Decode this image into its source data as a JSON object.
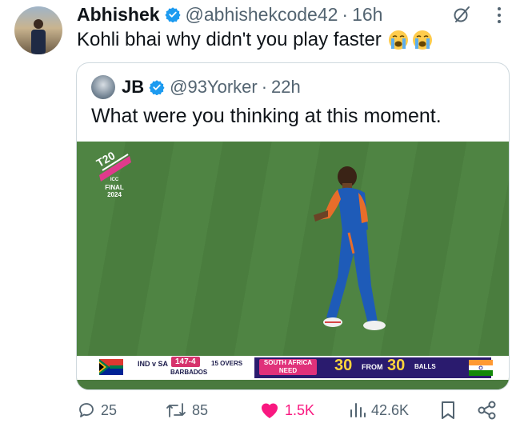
{
  "tweet": {
    "author_name": "Abhishek",
    "handle": "@abhishekcode42",
    "separator": "·",
    "time": "16h",
    "text": "Kohli bhai why didn't you play faster",
    "emojis": [
      "loudly-crying-face",
      "loudly-crying-face"
    ]
  },
  "quote": {
    "author_name": "JB",
    "handle": "@93Yorker",
    "separator": "·",
    "time": "22h",
    "text": "What were you thinking at this moment.",
    "media": {
      "logo_text": "T20",
      "logo_small": "ICC",
      "logo_final": "FINAL",
      "logo_year": "2024",
      "scorebar": {
        "teams": "IND v SA",
        "score": "147-4",
        "venue": "BARBADOS",
        "overs": "15 OVERS",
        "need_label_line1": "SOUTH AFRICA",
        "need_label_line2": "NEED",
        "runs": "30",
        "from": "FROM",
        "balls": "30",
        "balls_label": "BALLS"
      }
    }
  },
  "actions": {
    "replies": "25",
    "reposts": "85",
    "likes": "1.5K",
    "views": "42.6K"
  },
  "colors": {
    "verified": "#1d9bf0",
    "like": "#f91880",
    "muted": "#536471",
    "pitch": "#4f8443",
    "score_pink": "#d6336c",
    "scorebar_navy": "#2a1b6e"
  }
}
